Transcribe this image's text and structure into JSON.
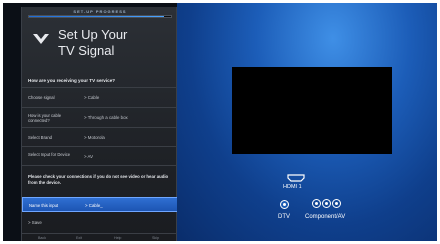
{
  "panel": {
    "progress_label": "SET-UP PROGRESS",
    "progress_fraction": 0.95,
    "title_line1": "Set Up Your",
    "title_line2": "TV Signal",
    "question": "How are you receiving your TV service?",
    "rows": [
      {
        "label": "Choose signal",
        "value": "> Cable"
      },
      {
        "label": "How is your cable connected?",
        "value": "> Through a cable box"
      },
      {
        "label": "Select Brand",
        "value": "> Motorola"
      },
      {
        "label": "Select Input for Device",
        "value": "> AV"
      }
    ],
    "notice": "Please check your connections if you do not see video or hear audio from the device.",
    "name_input": {
      "label": "Name this input",
      "value": "> Cable_"
    },
    "save_label": "> Save",
    "bottom_hints": [
      "Back",
      "Exit",
      "Help",
      "Skip"
    ]
  },
  "stage": {
    "hdmi_label": "HDMI 1",
    "dtv_label": "DTV",
    "component_label": "Component/AV"
  },
  "colors": {
    "accent_blue": "#2f6fd2",
    "stage_blue": "#1c5db8",
    "panel_bg": "#202328"
  }
}
